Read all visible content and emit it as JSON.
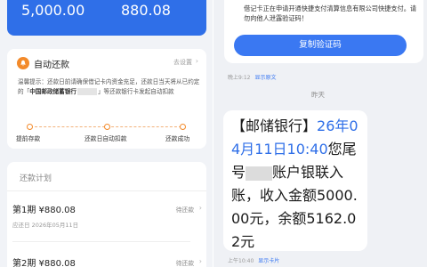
{
  "left": {
    "summary": {
      "amount1": "5,000.00",
      "amount2": "880.08"
    },
    "auto_repay": {
      "title": "自动还款",
      "go_settings": "去设置",
      "tip_prefix": "温馨提示：还款日前请确保借记卡内资金充足，还款日当天将从",
      "tip_middle": "已约定的「",
      "tip_bank": "中国邮政储蓄银行",
      "tip_suffix": "」等还款银行卡发起自动扣款",
      "steps": [
        "提前存款",
        "还款日自动扣款",
        "还款成功"
      ]
    },
    "plan": {
      "title": "还款计划",
      "periods": [
        {
          "label": "第1期 ¥880.08",
          "due": "应还日 2026年05月11日",
          "status": "待还款"
        },
        {
          "label": "第2期 ¥880.08",
          "due": "",
          "status": "待还款"
        }
      ]
    }
  },
  "right": {
    "prev_sms": {
      "text": "借记卡正在申请开通快捷支付清算信息有限公司快捷支付。请勿向他人泄露验证码！",
      "copy_button": "复制验证码",
      "time": "晚上9:12",
      "link": "显示原文"
    },
    "day_label": "昨天",
    "bank_sms": {
      "bank": "【邮储银行】",
      "date": "26年04月11日10:40",
      "line_a": "您尾号",
      "line_b": "账户银联入账，收入金额5000.00元，余额5162.02元",
      "time": "上午10:40",
      "link": "显示卡片"
    }
  },
  "colors": {
    "brand_blue": "#2f6fe8",
    "orange": "#f38a2a",
    "link_blue": "#3a78f2"
  }
}
